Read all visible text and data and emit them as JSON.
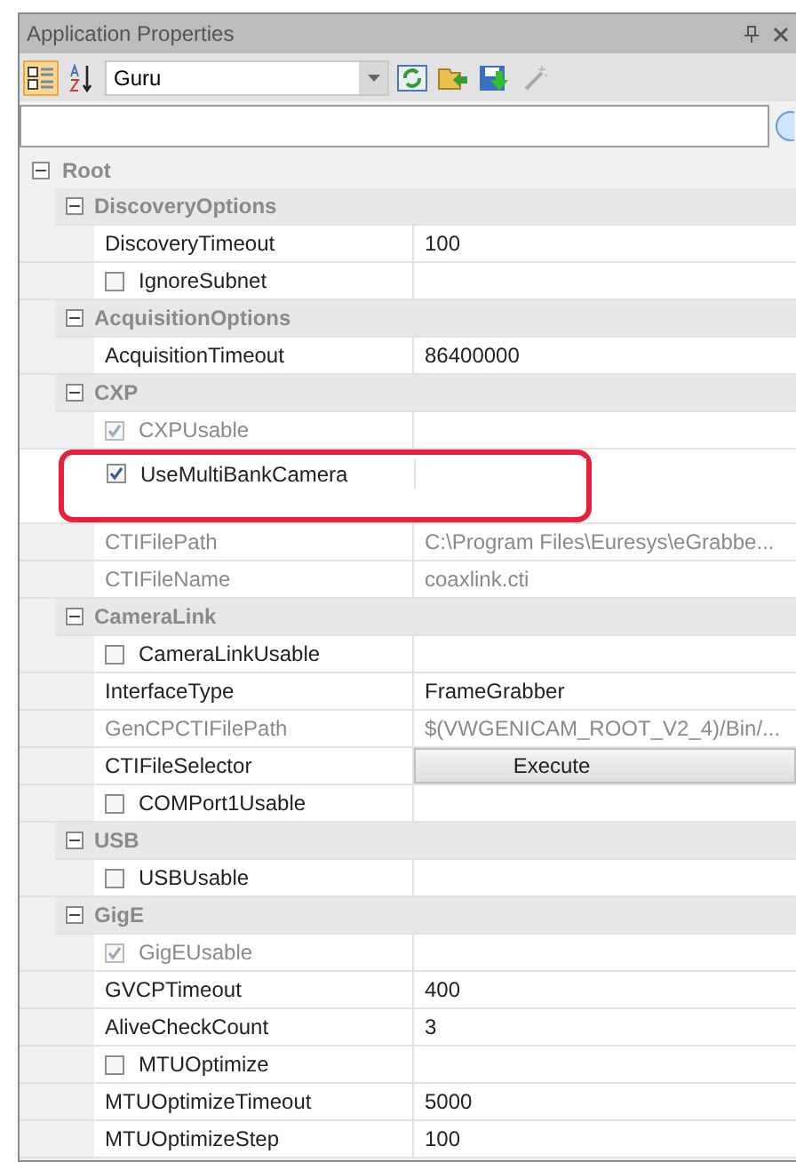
{
  "window": {
    "title": "Application Properties"
  },
  "toolbar": {
    "view_mode": "Guru",
    "categorized": true
  },
  "tree": {
    "label": "Root",
    "expanded": true,
    "children": [
      {
        "label": "DiscoveryOptions",
        "expanded": true,
        "properties": [
          {
            "kind": "value",
            "name": "DiscoveryTimeout",
            "value": "100",
            "disabled": false
          },
          {
            "kind": "checkbox",
            "name": "IgnoreSubnet",
            "checked": false,
            "disabled": false
          }
        ]
      },
      {
        "label": "AcquisitionOptions",
        "expanded": true,
        "properties": [
          {
            "kind": "value",
            "name": "AcquisitionTimeout",
            "value": "86400000",
            "disabled": false
          }
        ]
      },
      {
        "label": "CXP",
        "expanded": true,
        "properties": [
          {
            "kind": "checkbox",
            "name": "CXPUsable",
            "checked": true,
            "disabled": true
          },
          {
            "kind": "checkbox",
            "name": "UseMultiBankCamera",
            "checked": true,
            "disabled": false,
            "highlighted": true
          },
          {
            "kind": "value",
            "name": "CTIFilePath",
            "value": "C:\\Program Files\\Euresys\\eGrabbe...",
            "disabled": true
          },
          {
            "kind": "value",
            "name": "CTIFileName",
            "value": "coaxlink.cti",
            "disabled": true
          }
        ]
      },
      {
        "label": "CameraLink",
        "expanded": true,
        "properties": [
          {
            "kind": "checkbox",
            "name": "CameraLinkUsable",
            "checked": false,
            "disabled": false
          },
          {
            "kind": "value",
            "name": "InterfaceType",
            "value": "FrameGrabber",
            "disabled": false
          },
          {
            "kind": "value",
            "name": "GenCPCTIFilePath",
            "value": "$(VWGENICAM_ROOT_V2_4)/Bin/...",
            "disabled": true
          },
          {
            "kind": "button",
            "name": "CTIFileSelector",
            "value": "Execute",
            "disabled": false
          },
          {
            "kind": "checkbox",
            "name": "COMPort1Usable",
            "checked": false,
            "disabled": false
          }
        ]
      },
      {
        "label": "USB",
        "expanded": true,
        "properties": [
          {
            "kind": "checkbox",
            "name": "USBUsable",
            "checked": false,
            "disabled": false
          }
        ]
      },
      {
        "label": "GigE",
        "expanded": true,
        "properties": [
          {
            "kind": "checkbox",
            "name": "GigEUsable",
            "checked": true,
            "disabled": true
          },
          {
            "kind": "value",
            "name": "GVCPTimeout",
            "value": "400",
            "disabled": false
          },
          {
            "kind": "value",
            "name": "AliveCheckCount",
            "value": "3",
            "disabled": false
          },
          {
            "kind": "checkbox",
            "name": "MTUOptimize",
            "checked": false,
            "disabled": false
          },
          {
            "kind": "value",
            "name": "MTUOptimizeTimeout",
            "value": "5000",
            "disabled": false
          },
          {
            "kind": "value",
            "name": "MTUOptimizeStep",
            "value": "100",
            "disabled": false
          }
        ]
      }
    ]
  }
}
